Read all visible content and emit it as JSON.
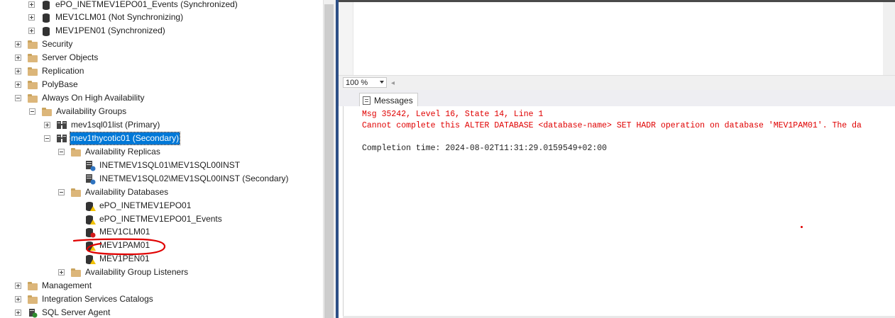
{
  "explorer": {
    "items": [
      {
        "label": "ePO_INETMEV1EPO01_Events (Synchronized)",
        "icon": "database-icon"
      },
      {
        "label": "MEV1CLM01 (Not Synchronizing)",
        "icon": "database-icon"
      },
      {
        "label": "MEV1PEN01 (Synchronized)",
        "icon": "database-icon"
      },
      {
        "label": "Security",
        "icon": "folder-icon"
      },
      {
        "label": "Server Objects",
        "icon": "folder-icon"
      },
      {
        "label": "Replication",
        "icon": "folder-icon"
      },
      {
        "label": "PolyBase",
        "icon": "folder-icon"
      },
      {
        "label": "Always On High Availability",
        "icon": "folder-icon"
      },
      {
        "label": "Availability Groups",
        "icon": "folder-icon"
      },
      {
        "label": "mev1sql01list (Primary)",
        "icon": "availability-group-icon"
      },
      {
        "label": "mev1thycotic01 (Secondary)",
        "icon": "availability-group-icon"
      },
      {
        "label": "Availability Replicas",
        "icon": "folder-icon"
      },
      {
        "label": "INETMEV1SQL01\\MEV1SQL00INST",
        "icon": "replica-icon"
      },
      {
        "label": "INETMEV1SQL02\\MEV1SQL00INST (Secondary)",
        "icon": "replica-icon"
      },
      {
        "label": "Availability Databases",
        "icon": "folder-icon"
      },
      {
        "label": "ePO_INETMEV1EPO01",
        "icon": "ag-database-warning-icon"
      },
      {
        "label": "ePO_INETMEV1EPO01_Events",
        "icon": "ag-database-warning-icon"
      },
      {
        "label": "MEV1CLM01",
        "icon": "ag-database-error-icon"
      },
      {
        "label": "MEV1PAM01",
        "icon": "ag-database-warning-icon"
      },
      {
        "label": "MEV1PEN01",
        "icon": "ag-database-warning-icon"
      },
      {
        "label": "Availability Group Listeners",
        "icon": "folder-icon"
      },
      {
        "label": "Management",
        "icon": "folder-icon"
      },
      {
        "label": "Integration Services Catalogs",
        "icon": "folder-icon"
      },
      {
        "label": "SQL Server Agent",
        "icon": "sql-agent-icon"
      }
    ]
  },
  "toolbar": {
    "zoom": "100 %"
  },
  "results": {
    "tab_label": "Messages",
    "lines": [
      "Msg 35242, Level 16, State 14, Line 1",
      "Cannot complete this ALTER DATABASE <database-name> SET HADR operation on database 'MEV1PAM01'. The da",
      "",
      "Completion time: 2024-08-02T11:31:29.0159549+02:00"
    ]
  },
  "colors": {
    "error_text": "#e00000",
    "selection": "#0078d7",
    "annotation": "#e00000"
  }
}
